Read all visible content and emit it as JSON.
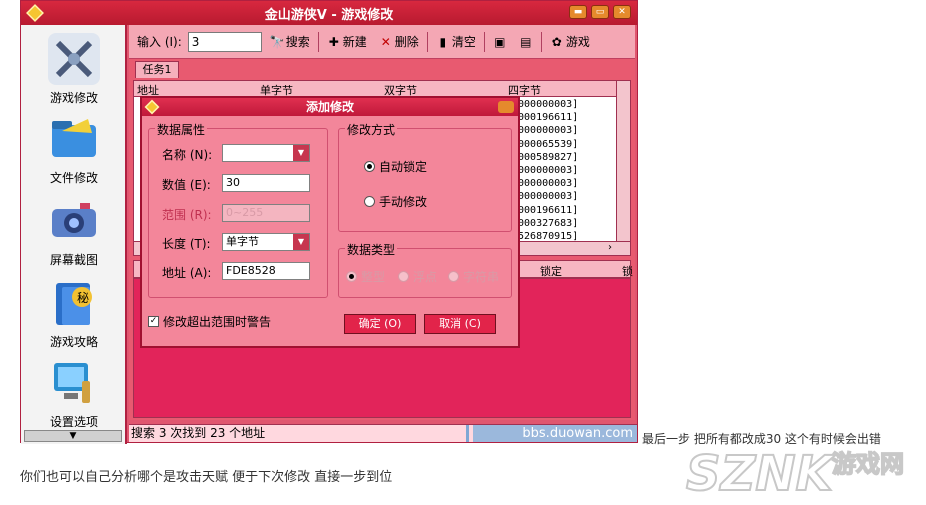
{
  "window": {
    "title": "金山游侠V - 游戏修改"
  },
  "sidebar": {
    "items": [
      {
        "label": "游戏修改",
        "icon": "crossed-swords-icon"
      },
      {
        "label": "文件修改",
        "icon": "folder-icon"
      },
      {
        "label": "屏幕截图",
        "icon": "camera-icon"
      },
      {
        "label": "游戏攻略",
        "icon": "secret-book-icon"
      },
      {
        "label": "设置选项",
        "icon": "monitor-settings-icon"
      }
    ],
    "scroll_arrow": "▼"
  },
  "toolbar": {
    "input_label": "输入 (I):",
    "input_value": "3",
    "search_label": "搜索",
    "new_label": "新建",
    "delete_label": "删除",
    "clear_label": "清空",
    "game_label": "游戏"
  },
  "tabs": [
    {
      "label": "任务1"
    }
  ],
  "grid": {
    "columns": [
      "地址",
      "单字节",
      "双字节",
      "四字节"
    ],
    "four_byte_values": [
      "0000000003]",
      "0000196611]",
      "0000000003]",
      "0000065539]",
      "0000589827]",
      "0000000003]",
      "0000000003]",
      "0000000003]",
      "0000196611]",
      "0000327683]",
      "0526870915]"
    ]
  },
  "grid2": {
    "columns": [
      "锁定",
      "锁"
    ]
  },
  "status": {
    "left": "搜索 3 次找到 23 个地址",
    "right": "bbs.duowan.com"
  },
  "dialog": {
    "title": "添加修改",
    "data_props_title": "数据属性",
    "name_label": "名称 (N):",
    "name_value": "",
    "value_label": "数值 (E):",
    "value_value": "30",
    "range_label": "范围 (R):",
    "range_value": "0~255",
    "length_label": "长度 (T):",
    "length_value": "单字节",
    "address_label": "地址 (A):",
    "address_value": "FDE8528",
    "modify_title": "修改方式",
    "auto_lock": "自动锁定",
    "manual_modify": "手动修改",
    "data_type_title": "数据类型",
    "type_int": "整型",
    "type_float": "浮点",
    "type_string": "字符串",
    "warn_check": "修改超出范围时警告",
    "ok_label": "确定 (O)",
    "cancel_label": "取消 (C)"
  },
  "captions": {
    "line1": "最后一步 把所有都改成30   这个有时候会出错",
    "line2": "你们也可以自己分析哪个是攻击天赋     便于下次修改  直接一步到位"
  },
  "watermark": {
    "brand": "SZNK",
    "cn": "游戏网"
  }
}
